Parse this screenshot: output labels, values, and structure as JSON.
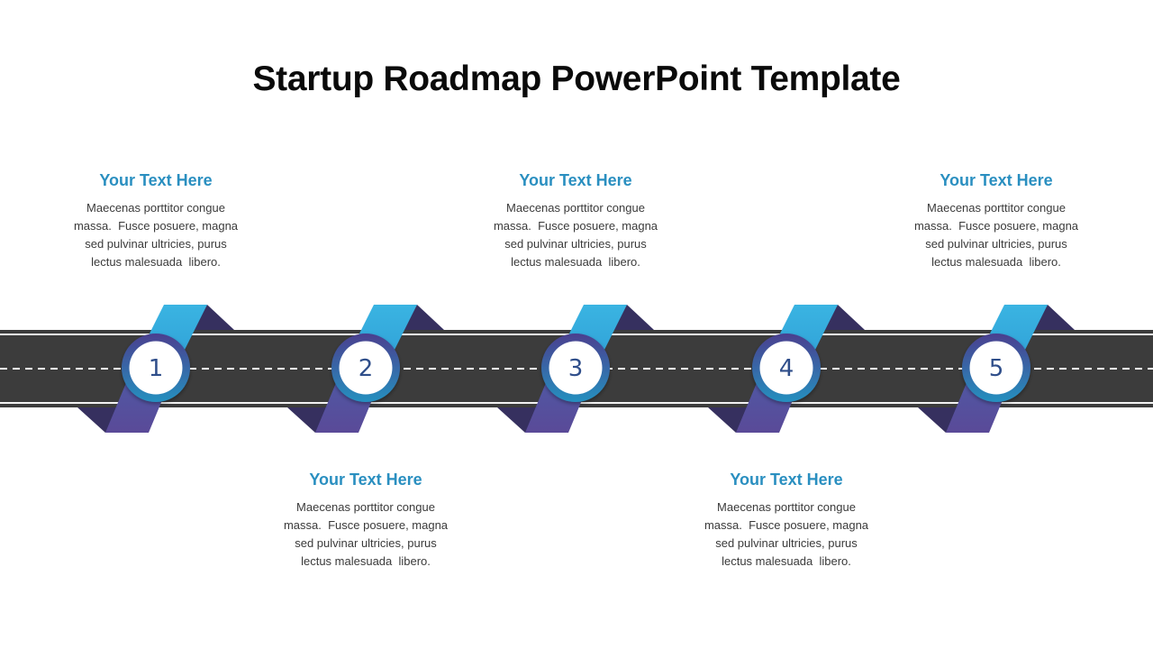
{
  "title": "Startup Roadmap PowerPoint Template",
  "colors": {
    "heading": "#2a8fc0",
    "road": "#3c3c3c",
    "ribbon_top": "#3bb0e0",
    "ribbon_bottom": "#5a4f99",
    "ribbon_fold": "#36305f",
    "ring_top": "#4a3f8f",
    "ring_bottom": "#2a8fc0"
  },
  "milestones": [
    {
      "number": "1",
      "position": "top",
      "heading": "Your Text Here",
      "lines": [
        "Maecenas porttitor congue",
        "massa.  Fusce posuere, magna",
        "sed pulvinar ultricies, purus",
        "lectus malesuada  libero."
      ]
    },
    {
      "number": "2",
      "position": "bottom",
      "heading": "Your Text Here",
      "lines": [
        "Maecenas porttitor congue",
        "massa.  Fusce posuere, magna",
        "sed pulvinar ultricies, purus",
        "lectus malesuada  libero."
      ]
    },
    {
      "number": "3",
      "position": "top",
      "heading": "Your Text Here",
      "lines": [
        "Maecenas porttitor congue",
        "massa.  Fusce posuere, magna",
        "sed pulvinar ultricies, purus",
        "lectus malesuada  libero."
      ]
    },
    {
      "number": "4",
      "position": "bottom",
      "heading": "Your Text Here",
      "lines": [
        "Maecenas porttitor congue",
        "massa.  Fusce posuere, magna",
        "sed pulvinar ultricies, purus",
        "lectus malesuada  libero."
      ]
    },
    {
      "number": "5",
      "position": "top",
      "heading": "Your Text Here",
      "lines": [
        "Maecenas porttitor congue",
        "massa.  Fusce posuere, magna",
        "sed pulvinar ultricies, purus",
        "lectus malesuada  libero."
      ]
    }
  ]
}
